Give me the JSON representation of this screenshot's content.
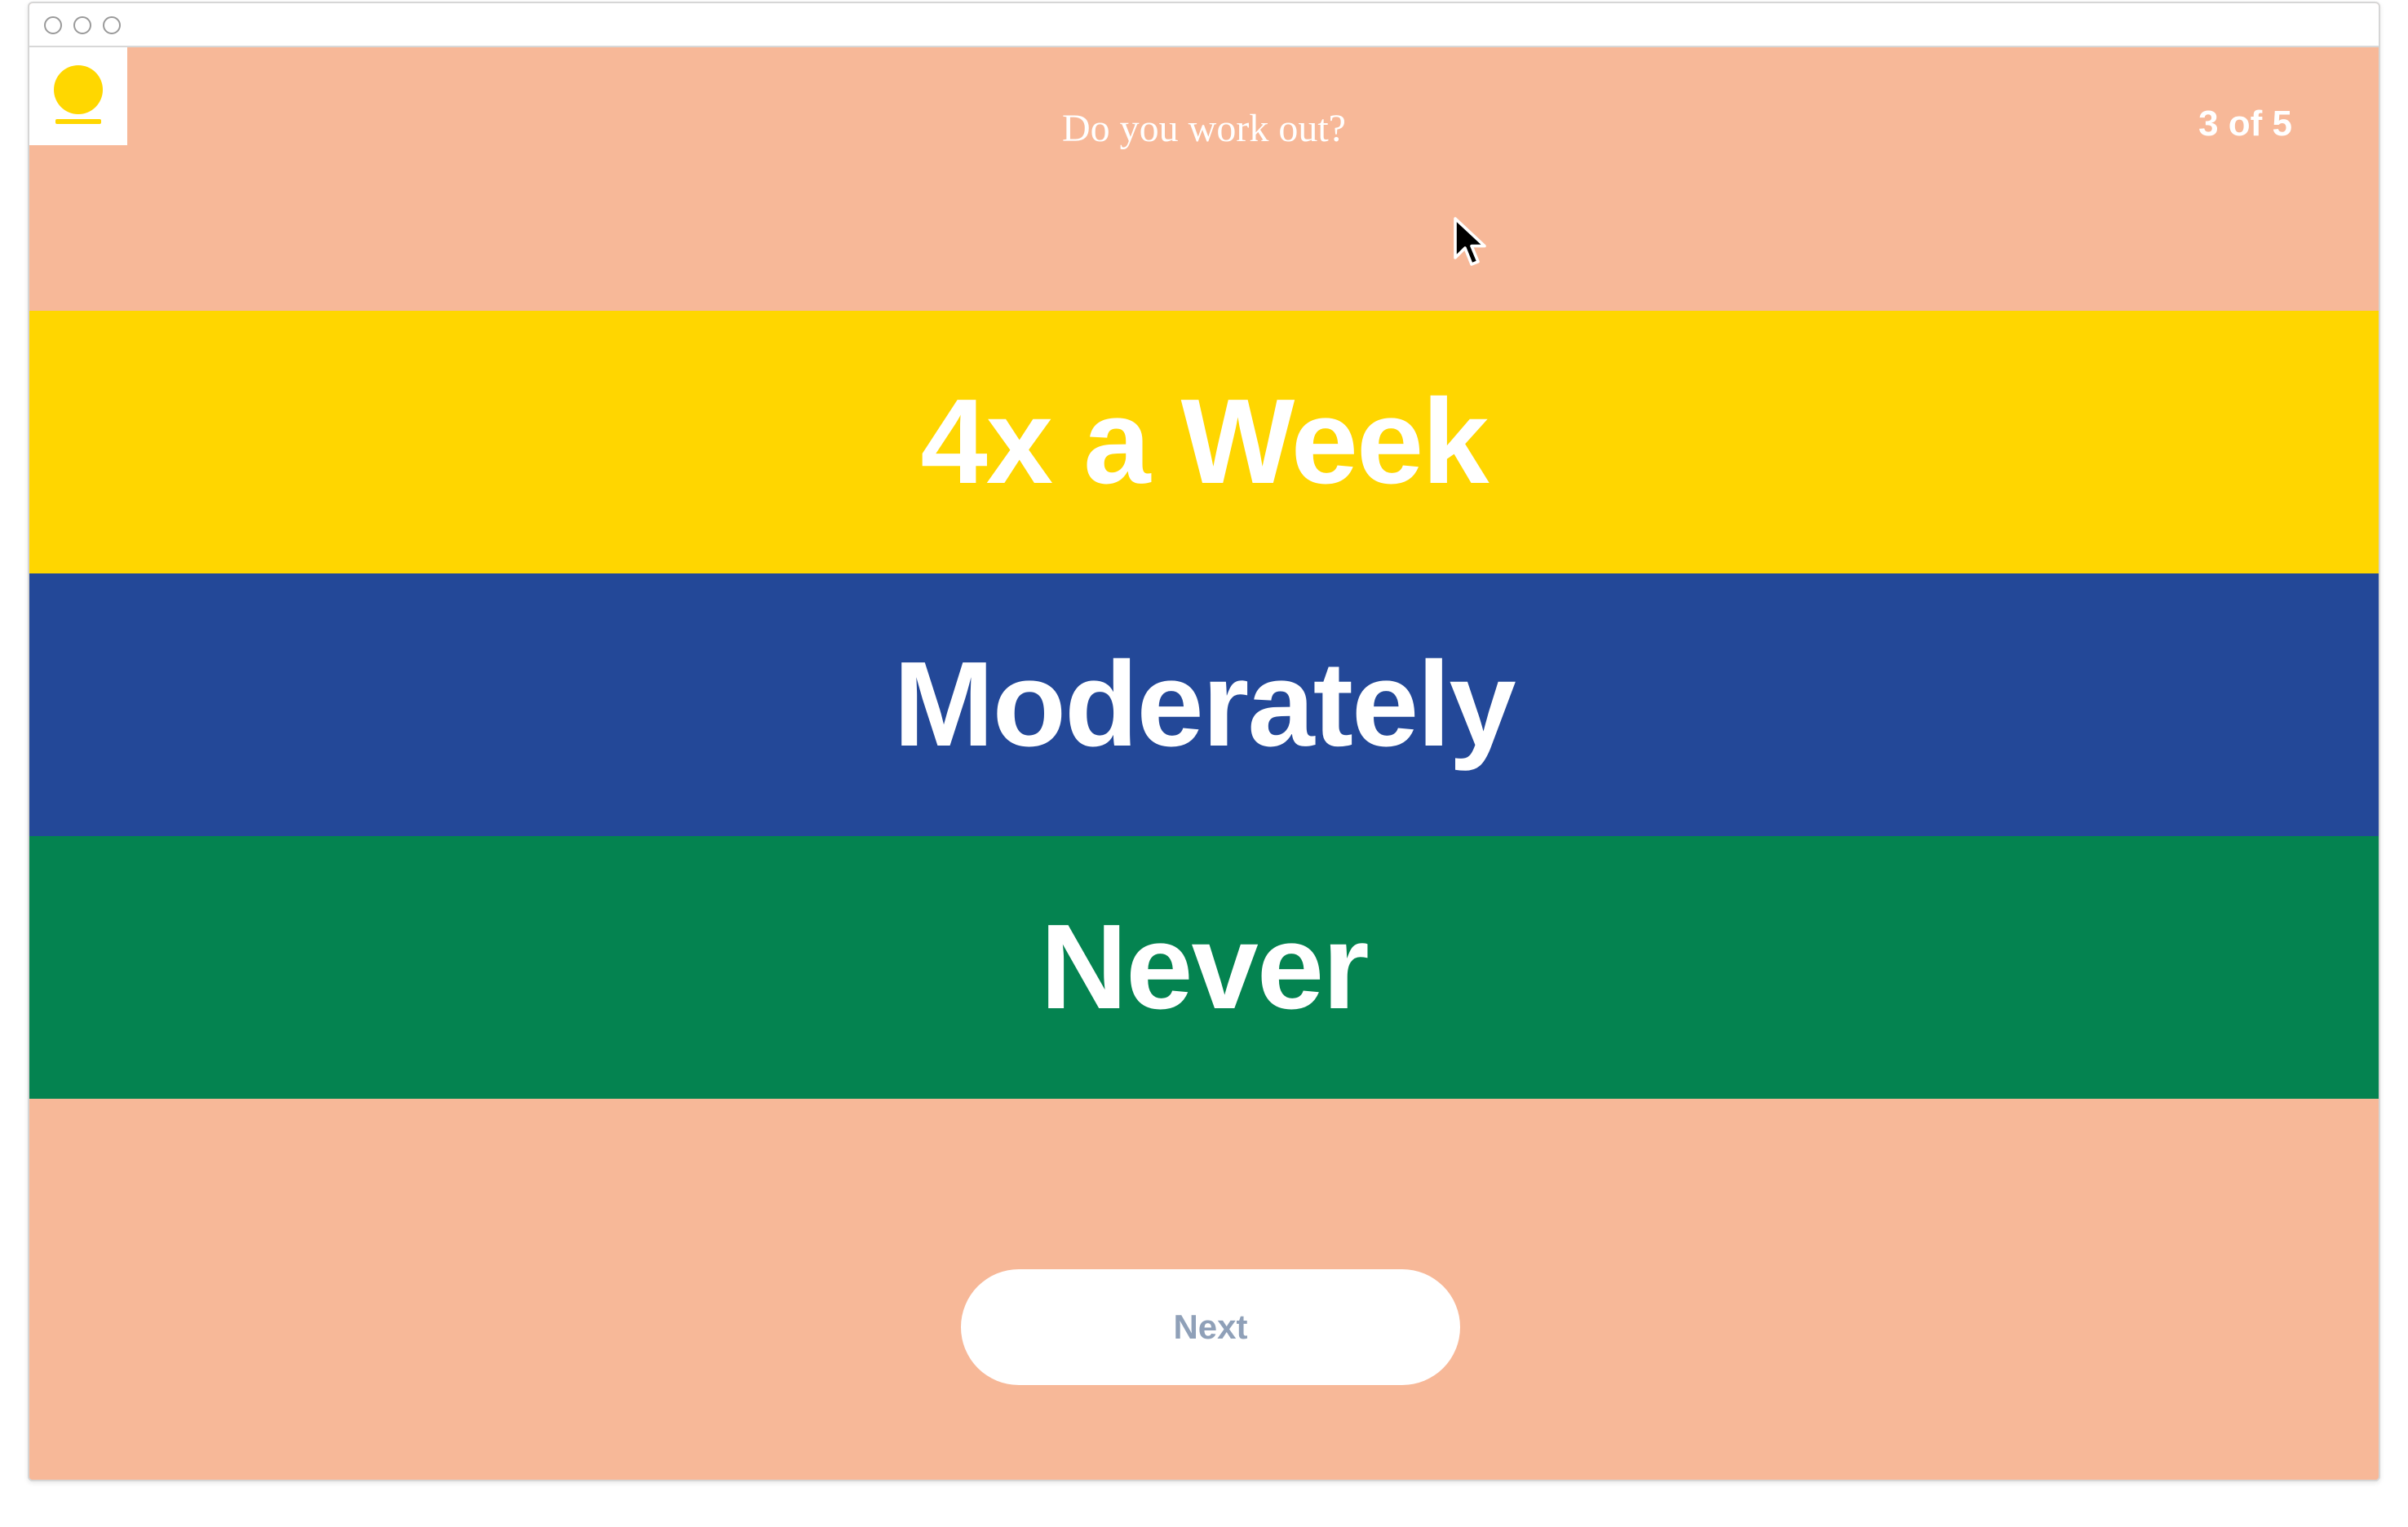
{
  "window": {
    "controls": [
      "close",
      "minimize",
      "zoom"
    ]
  },
  "brand": {
    "logo_icon": "sun-icon",
    "accent_color": "#ffd700"
  },
  "quiz": {
    "question": "Do you work out?",
    "progress": "3 of 5",
    "background_color": "#f7b898",
    "options": [
      {
        "label": "4x a Week",
        "color": "#ffd600"
      },
      {
        "label": "Moderately",
        "color": "#234898"
      },
      {
        "label": "Never",
        "color": "#048350"
      }
    ],
    "next_label": "Next"
  },
  "pointer": {
    "icon": "mouse-pointer-icon"
  }
}
